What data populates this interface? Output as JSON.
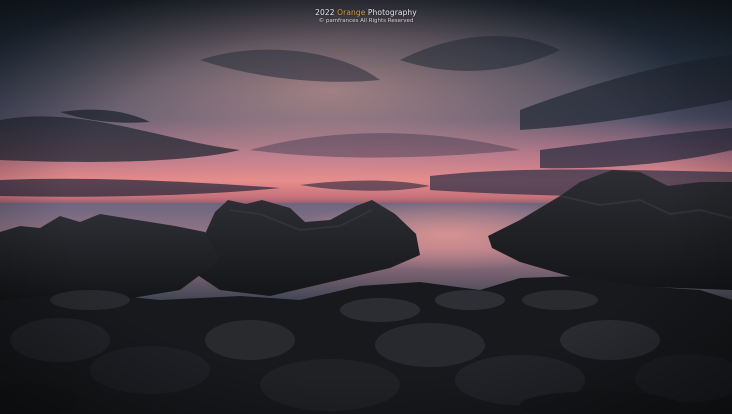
{
  "watermark": {
    "year": "2022",
    "brand": "Orange",
    "suffix": " Photography",
    "copyright": "© pamfrances  All Rights Reserved"
  },
  "colors": {
    "sky_top": "#1c2530",
    "sunset_pink": "#e88a8a",
    "sea_glow": "#d98b8b",
    "rocks": "#1a1c20",
    "watermark_accent": "#d99a3c"
  }
}
